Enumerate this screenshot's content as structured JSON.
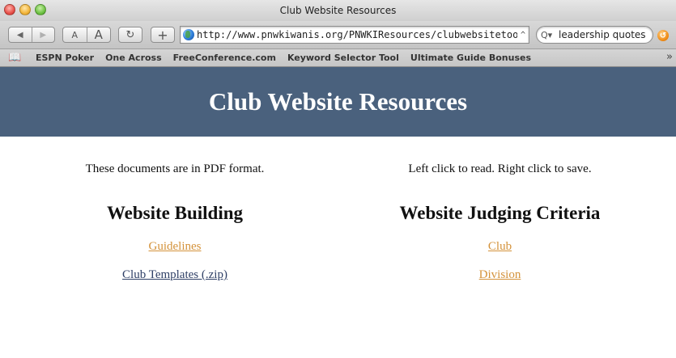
{
  "window": {
    "title": "Club Website Resources"
  },
  "toolbar": {
    "back_glyph": "◀",
    "forward_glyph": "▶",
    "text_small": "A",
    "text_large": "A",
    "reload_glyph": "↻",
    "add_bookmark_glyph": "+",
    "url": "http://www.pnwkiwanis.org/PNWKIResources/clubwebsitetools.ht",
    "url_snap_glyph": "^",
    "search_glyph": "Q▾",
    "search_value": "leadership quotes",
    "snapback_glyph": "↺"
  },
  "bookmarks": {
    "book_glyph": "📖",
    "items": [
      "ESPN Poker",
      "One Across",
      "FreeConference.com",
      "Keyword Selector Tool",
      "Ultimate Guide Bonuses"
    ],
    "more_glyph": "»"
  },
  "page": {
    "banner_title": "Club Website Resources",
    "left": {
      "note": "These documents are in PDF format.",
      "heading": "Website Building",
      "links": [
        "Guidelines",
        "Club Templates (.zip)"
      ]
    },
    "right": {
      "note": "Left click to read. Right click to save.",
      "heading": "Website Judging Criteria",
      "links": [
        "Club",
        "Division"
      ]
    }
  },
  "colors": {
    "banner_bg": "#4a617d",
    "link_visited": "#d4923a",
    "link_default": "#2e3f66"
  }
}
